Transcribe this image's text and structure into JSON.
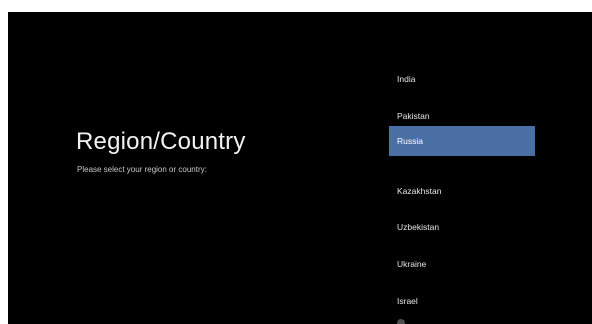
{
  "page": {
    "title": "Region/Country",
    "subtitle": "Please select your region or country:"
  },
  "country_list": {
    "selected": "Russia",
    "items": [
      {
        "label": "India"
      },
      {
        "label": "Pakistan"
      },
      {
        "label": "Russia"
      },
      {
        "label": "Kazakhstan"
      },
      {
        "label": "Uzbekistan"
      },
      {
        "label": "Ukraine"
      },
      {
        "label": "Israel"
      }
    ]
  },
  "colors": {
    "background": "#000000",
    "selection": "#4a6fa5",
    "text": "#e6e6e6"
  }
}
